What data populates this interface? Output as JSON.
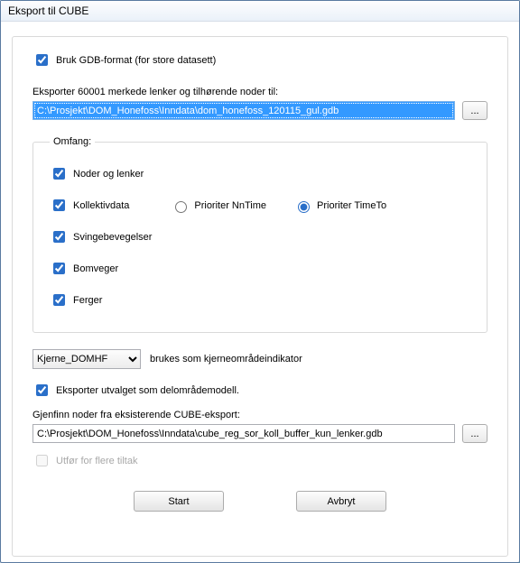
{
  "title": "Eksport til CUBE",
  "gdb": {
    "label": "Bruk GDB-format (for store datasett)",
    "checked": true
  },
  "export_heading": "Eksporter 60001 merkede lenker og tilhørende noder til:",
  "export_path": "C:\\Prosjekt\\DOM_Honefoss\\Inndata\\dom_honefoss_120115_gul.gdb",
  "browse": "...",
  "omfang": {
    "legend": "Omfang:",
    "noder": {
      "label": "Noder og lenker",
      "checked": true
    },
    "kollektiv": {
      "label": "Kollektivdata",
      "checked": true
    },
    "radio_nn": "Prioriter NnTime",
    "radio_tt": "Prioriter TimeTo",
    "svinge": {
      "label": "Svingebevegelser",
      "checked": true
    },
    "bomveger": {
      "label": "Bomveger",
      "checked": true
    },
    "ferger": {
      "label": "Ferger",
      "checked": true
    }
  },
  "kjerne": {
    "selected": "Kjerne_DOMHF",
    "desc": "brukes som kjerneområdeindikator"
  },
  "delomrade": {
    "label": "Eksporter utvalget som delområdemodell.",
    "checked": true
  },
  "gjenfinn": {
    "label": "Gjenfinn noder fra eksisterende CUBE-eksport:",
    "path": "C:\\Prosjekt\\DOM_Honefoss\\Inndata\\cube_reg_sor_koll_buffer_kun_lenker.gdb"
  },
  "tiltak": {
    "label": "Utfør for flere tiltak"
  },
  "buttons": {
    "start": "Start",
    "avbryt": "Avbryt"
  }
}
